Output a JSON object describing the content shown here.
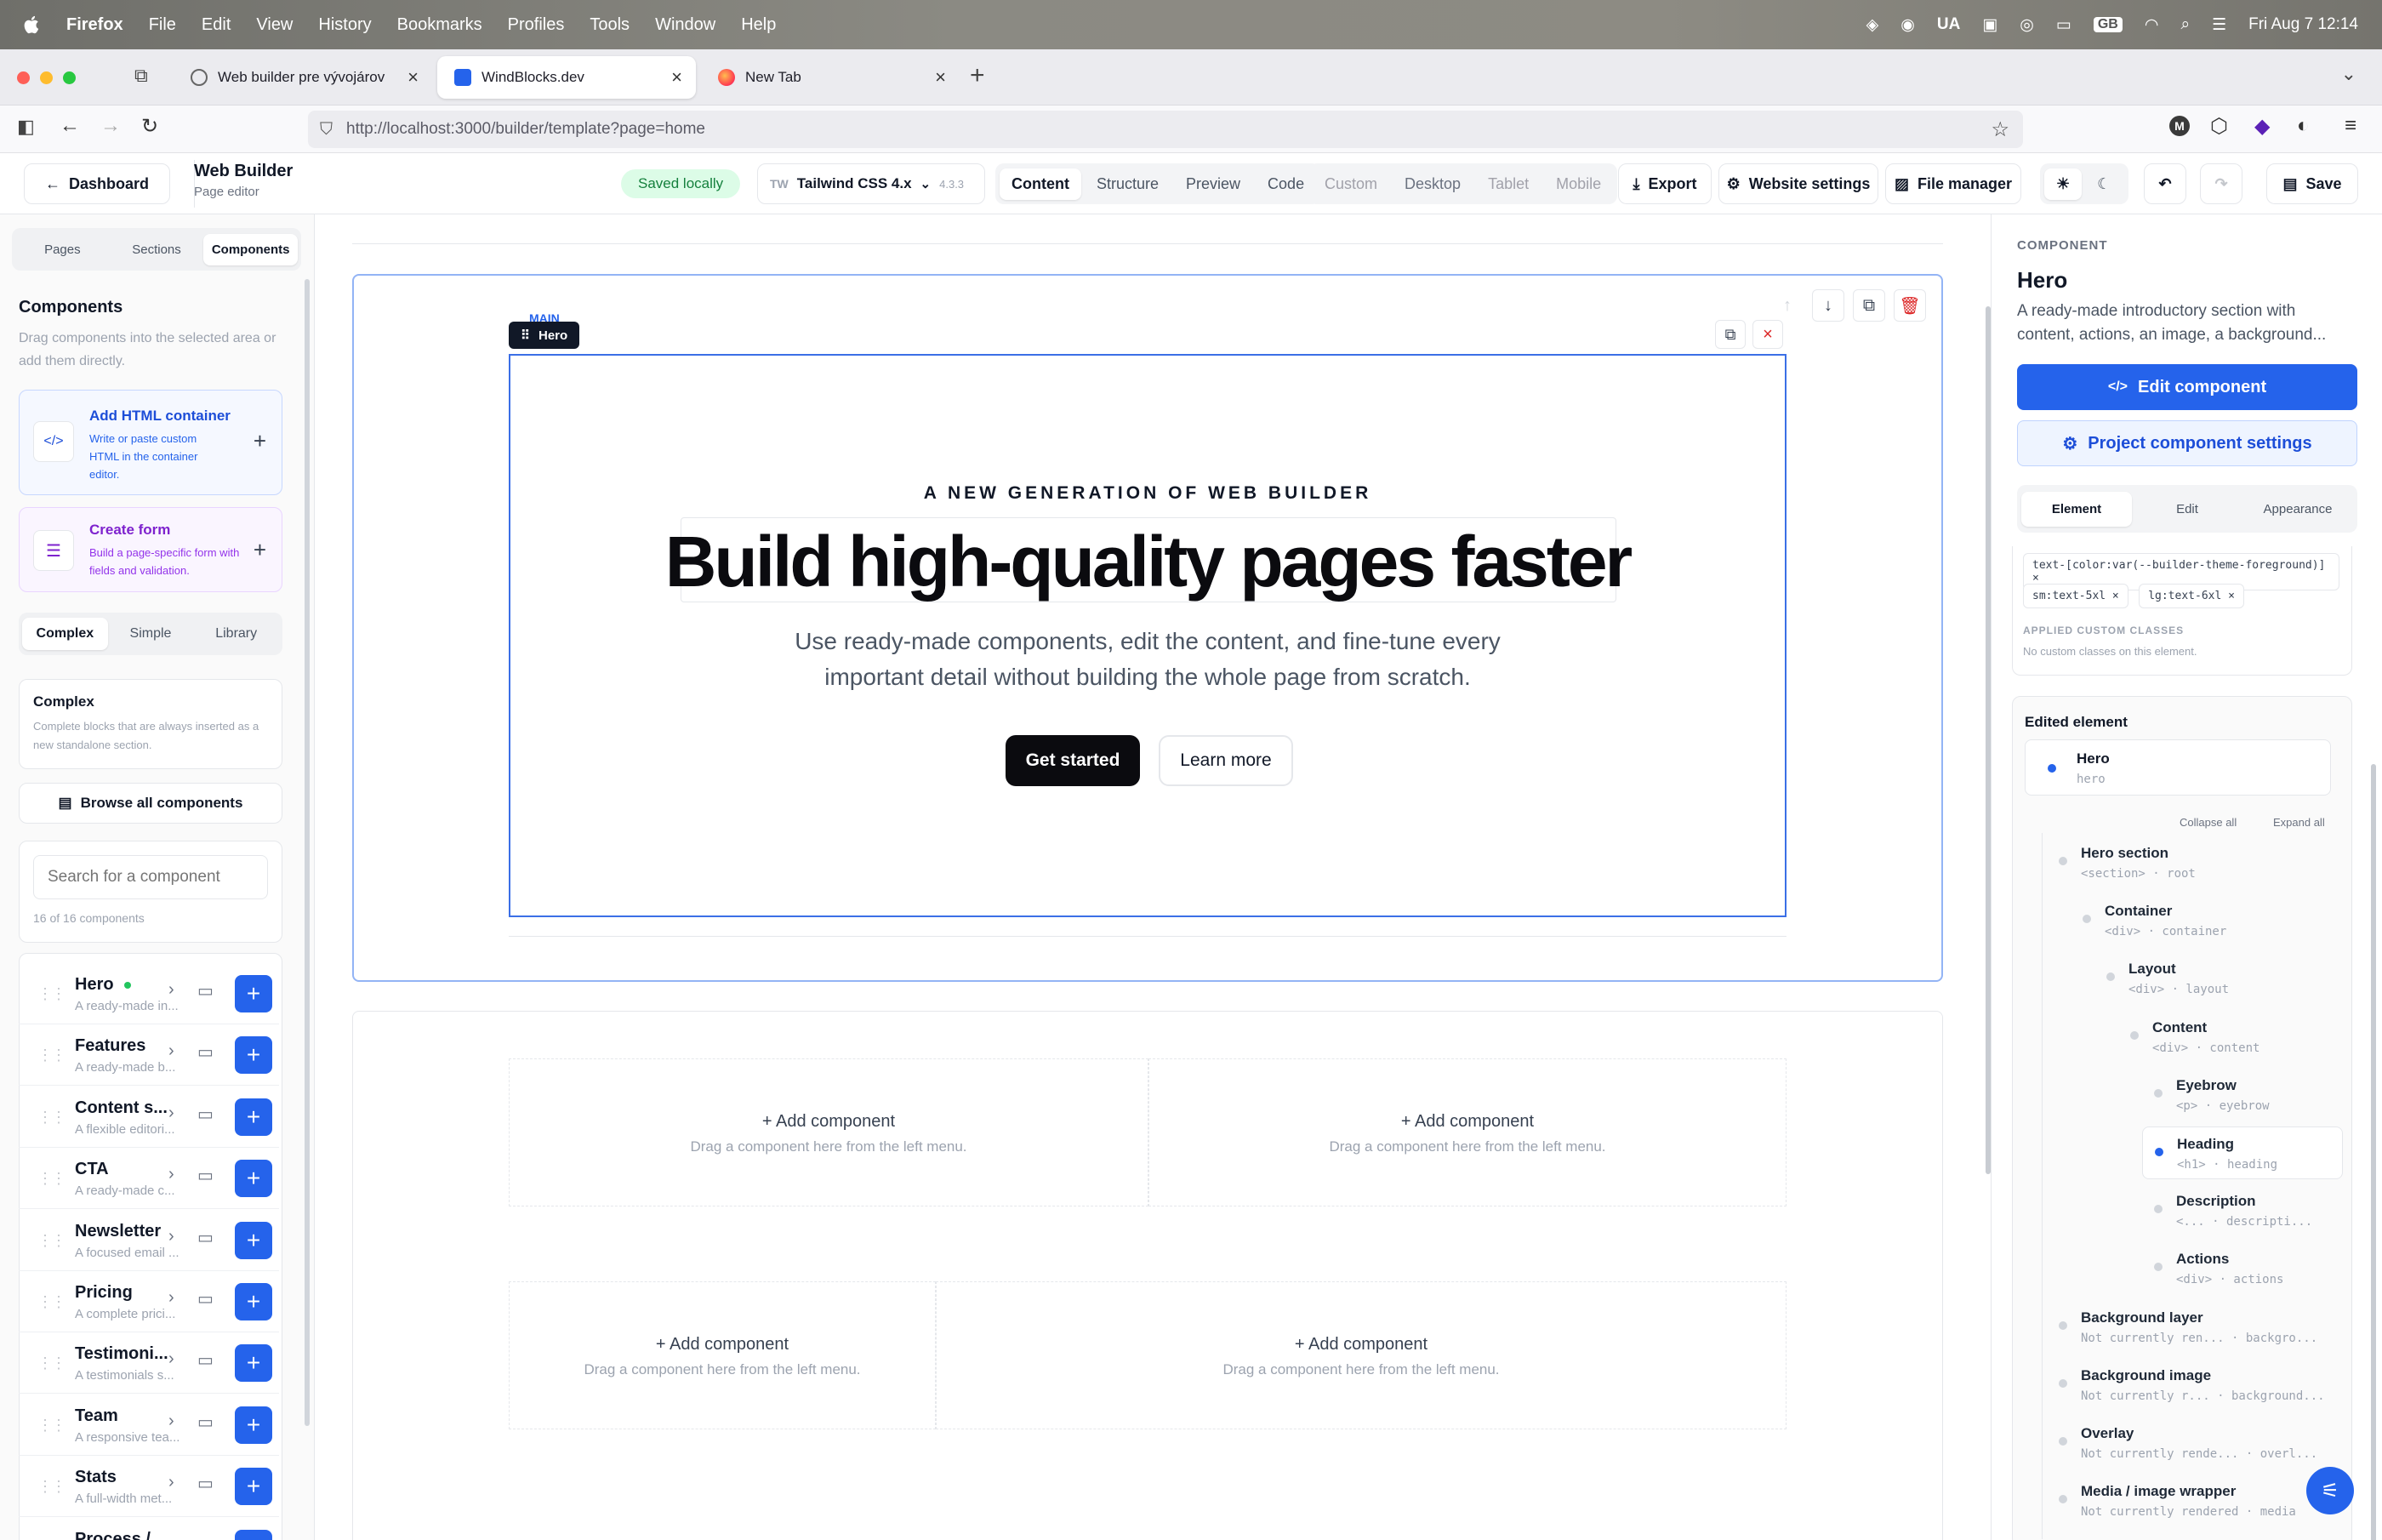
{
  "menubar": {
    "app": "Firefox",
    "items": [
      "File",
      "Edit",
      "View",
      "History",
      "Bookmarks",
      "Profiles",
      "Tools",
      "Window",
      "Help"
    ],
    "lang": "UA",
    "kbd": "GB",
    "datetime": "Fri Aug 7  12:14"
  },
  "tabs": [
    {
      "title": "Web builder pre vývojárov"
    },
    {
      "title": "WindBlocks.dev"
    },
    {
      "title": "New Tab"
    }
  ],
  "url": "http://localhost:3000/builder/template?page=home",
  "toolbar": {
    "back_label": "Dashboard",
    "title": "Web Builder",
    "subtitle": "Page editor",
    "saved": "Saved locally",
    "tw_badge": "TW",
    "framework": "Tailwind CSS 4.x",
    "version": "4.3.3",
    "modes": [
      "Content",
      "Structure",
      "Preview",
      "Code"
    ],
    "devices": [
      "Custom",
      "Desktop",
      "Tablet",
      "Mobile"
    ],
    "export": "Export",
    "website_settings": "Website settings",
    "file_manager": "File manager",
    "save": "Save"
  },
  "sidebar": {
    "tabs": [
      "Pages",
      "Sections",
      "Components"
    ],
    "heading": "Components",
    "intro": "Drag components into the selected area or add them directly.",
    "add_html": {
      "title": "Add HTML container",
      "desc": "Write or paste custom HTML in the container editor."
    },
    "create_form": {
      "title": "Create form",
      "desc": "Build a page-specific form with fields and validation."
    },
    "filters": [
      "Complex",
      "Simple",
      "Library"
    ],
    "complex_title": "Complex",
    "complex_desc": "Complete blocks that are always inserted as a new standalone section.",
    "browse": "Browse all components",
    "search_placeholder": "Search for a component",
    "count": "16 of 16 components",
    "components": [
      {
        "name": "Hero",
        "desc": "A ready-made in..."
      },
      {
        "name": "Features",
        "desc": "A ready-made b..."
      },
      {
        "name": "Content s...",
        "desc": "A flexible editori..."
      },
      {
        "name": "CTA",
        "desc": "A ready-made c..."
      },
      {
        "name": "Newsletter",
        "desc": "A focused email ..."
      },
      {
        "name": "Pricing",
        "desc": "A complete prici..."
      },
      {
        "name": "Testimoni...",
        "desc": "A testimonials s..."
      },
      {
        "name": "Team",
        "desc": "A responsive tea..."
      },
      {
        "name": "Stats",
        "desc": "A full-width met..."
      },
      {
        "name": "Process /...",
        "desc": ""
      }
    ]
  },
  "canvas": {
    "main_tag": "MAIN",
    "hero_tag": "Hero",
    "eyebrow": "A NEW GENERATION OF WEB BUILDER",
    "heading": "Build high-quality pages faster",
    "description_1": "Use ready-made components, edit the content, and fine-tune every",
    "description_2": "important detail without building the whole page from scratch.",
    "primary_cta": "Get started",
    "secondary_cta": "Learn more",
    "dropzone_title": "+ Add component",
    "dropzone_hint": "Drag a component here from the left menu."
  },
  "rpanel": {
    "label": "COMPONENT",
    "title": "Hero",
    "desc": "A ready-made introductory section with content, actions, an image, a background...",
    "edit_btn": "Edit component",
    "settings_btn": "Project component settings",
    "tabs": [
      "Element",
      "Edit",
      "Appearance"
    ],
    "chips": [
      "text-[color:var(--builder-theme-foreground)] ×",
      "sm:text-5xl ×",
      "lg:text-6xl ×"
    ],
    "applied_label": "APPLIED CUSTOM CLASSES",
    "applied_none": "No custom classes on this element.",
    "edited_label": "Edited element",
    "edited_name": "Hero",
    "edited_key": "hero",
    "collapse_all": "Collapse all",
    "expand_all": "Expand all",
    "tree": [
      {
        "name": "Hero section",
        "sub": "<section> · root"
      },
      {
        "name": "Container",
        "sub": "<div> · container"
      },
      {
        "name": "Layout",
        "sub": "<div> · layout"
      },
      {
        "name": "Content",
        "sub": "<div> · content"
      },
      {
        "name": "Eyebrow",
        "sub": "<p> · eyebrow"
      },
      {
        "name": "Heading",
        "sub": "<h1> · heading"
      },
      {
        "name": "Description",
        "sub": "<... · descripti..."
      },
      {
        "name": "Actions",
        "sub": "<div> · actions"
      },
      {
        "name": "Background layer",
        "sub": "Not currently ren...  · backgro..."
      },
      {
        "name": "Background image",
        "sub": "Not currently r...  · background..."
      },
      {
        "name": "Overlay",
        "sub": "Not currently rende...  · overl..."
      },
      {
        "name": "Media / image wrapper",
        "sub": "Not currently rendered · media"
      }
    ]
  },
  "colors": {
    "accent": "#2563eb",
    "saved_bg": "#dcfce7",
    "saved_fg": "#15803d",
    "danger": "#dc2626"
  }
}
